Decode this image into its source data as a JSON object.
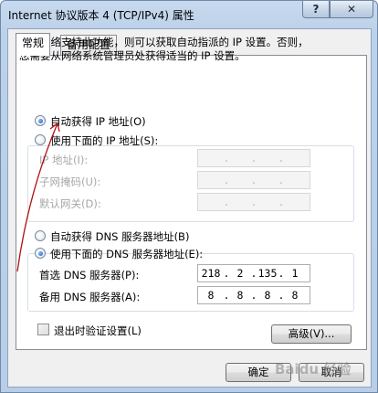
{
  "window": {
    "title": "Internet 协议版本 4 (TCP/IPv4) 属性",
    "help_label": "?",
    "close_label": "✕"
  },
  "tabs": [
    {
      "label": "常规",
      "active": true
    },
    {
      "label": "备用配置",
      "active": false
    }
  ],
  "description": {
    "line1": "如果网络支持此功能，则可以获取自动指派的 IP 设置。否则，",
    "line2": "您需要从网络系统管理员处获得适当的 IP 设置。"
  },
  "ip_section": {
    "auto_label": "自动获得 IP 地址(O)",
    "manual_label": "使用下面的 IP 地址(S):",
    "selected": "auto",
    "fields": [
      {
        "label": "IP 地址(I):",
        "octets": [
          "",
          "",
          "",
          ""
        ]
      },
      {
        "label": "子网掩码(U):",
        "octets": [
          "",
          "",
          "",
          ""
        ]
      },
      {
        "label": "默认网关(D):",
        "octets": [
          "",
          "",
          "",
          ""
        ]
      }
    ]
  },
  "dns_section": {
    "auto_label": "自动获得 DNS 服务器地址(B)",
    "manual_label": "使用下面的 DNS 服务器地址(E):",
    "selected": "manual",
    "preferred": {
      "label": "首选 DNS 服务器(P):",
      "octets": [
        "218",
        "2",
        "135",
        "1"
      ]
    },
    "alternate": {
      "label": "备用 DNS 服务器(A):",
      "octets": [
        "8",
        "8",
        "8",
        "8"
      ]
    }
  },
  "validate_checkbox": {
    "label": "退出时验证设置(L)",
    "checked": false
  },
  "buttons": {
    "advanced": "高级(V)...",
    "ok": "确定",
    "cancel": "取消"
  },
  "watermark": "Baidu 经验",
  "colors": {
    "title_gradient": "#c7d9ee",
    "dialog_bg": "#f0f0f0",
    "radio_fill": "#1e5fbf",
    "annotation_arrow": "#b01010"
  }
}
